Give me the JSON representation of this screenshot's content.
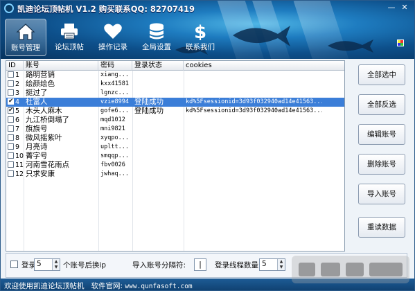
{
  "window": {
    "title": "凯迪论坛顶帖机 V1.2 购买联系QQ: 82707419",
    "minimize": "—",
    "close": "✕"
  },
  "nav": [
    {
      "label": "账号管理",
      "icon": "home-icon",
      "active": true
    },
    {
      "label": "论坛顶帖",
      "icon": "printer-icon",
      "active": false
    },
    {
      "label": "操作记录",
      "icon": "heart-icon",
      "active": false
    },
    {
      "label": "全局设置",
      "icon": "coins-stack-icon",
      "active": false
    },
    {
      "label": "联系我们",
      "icon": "dollar-icon",
      "active": false
    }
  ],
  "table": {
    "headers": {
      "id": "ID",
      "account": "账号",
      "password": "密码",
      "status": "登录状态",
      "cookies": "cookies"
    },
    "rows": [
      {
        "id": "1",
        "account": "路明营销",
        "password": "xiang...",
        "status": "",
        "cookies": "",
        "checked": false,
        "selected": false
      },
      {
        "id": "2",
        "account": "绘颜绘色",
        "password": "kxx41581",
        "status": "",
        "cookies": "",
        "checked": false,
        "selected": false
      },
      {
        "id": "3",
        "account": "挺过了",
        "password": "lgnzc...",
        "status": "",
        "cookies": "",
        "checked": false,
        "selected": false
      },
      {
        "id": "4",
        "account": "杜富人",
        "password": "vzie8994",
        "status": "登陆成功",
        "cookies": "kd%5Fsessionid=3d93f032940ad14e41563...",
        "checked": true,
        "selected": true
      },
      {
        "id": "5",
        "account": "木头人麻木",
        "password": "gofe6...",
        "status": "登陆成功",
        "cookies": "kd%5Fsessionid=3d93f032940ad14e41563...",
        "checked": true,
        "selected": false
      },
      {
        "id": "6",
        "account": "九江桥倒塌了",
        "password": "mqd1012",
        "status": "",
        "cookies": "",
        "checked": false,
        "selected": false
      },
      {
        "id": "7",
        "account": "旗旗号",
        "password": "mni9821",
        "status": "",
        "cookies": "",
        "checked": false,
        "selected": false
      },
      {
        "id": "8",
        "account": "微风摇紫叶",
        "password": "xyqpo...",
        "status": "",
        "cookies": "",
        "checked": false,
        "selected": false
      },
      {
        "id": "9",
        "account": "月亮诗",
        "password": "upltt...",
        "status": "",
        "cookies": "",
        "checked": false,
        "selected": false
      },
      {
        "id": "10",
        "account": "菁字号",
        "password": "smqqp...",
        "status": "",
        "cookies": "",
        "checked": false,
        "selected": false
      },
      {
        "id": "11",
        "account": "河南雪花雨点",
        "password": "fbv0026",
        "status": "",
        "cookies": "",
        "checked": false,
        "selected": false
      },
      {
        "id": "12",
        "account": "只求安康",
        "password": "jwhaq...",
        "status": "",
        "cookies": "",
        "checked": false,
        "selected": false
      }
    ]
  },
  "side_buttons": {
    "select_all": "全部选中",
    "invert": "全部反选",
    "edit": "编辑账号",
    "delete": "删除账号",
    "import": "导入账号",
    "reload": "重读数据"
  },
  "settings": {
    "login_label": "登录",
    "login_count": "5",
    "switch_label": "个账号后换ip",
    "separator_label": "导入账号分隔符:",
    "separator_value": "|",
    "threads_label": "登录线程数量",
    "threads_value": "5"
  },
  "footer": {
    "welcome": "欢迎使用凯迪论坛顶帖机",
    "site_label": "软件官网:",
    "site_url": "www.qunfasoft.com"
  },
  "colors": {
    "header_dark": "#08345f",
    "header_light": "#4fb6e6",
    "selection": "#3b7ed8",
    "footer": "#1d5c96"
  }
}
